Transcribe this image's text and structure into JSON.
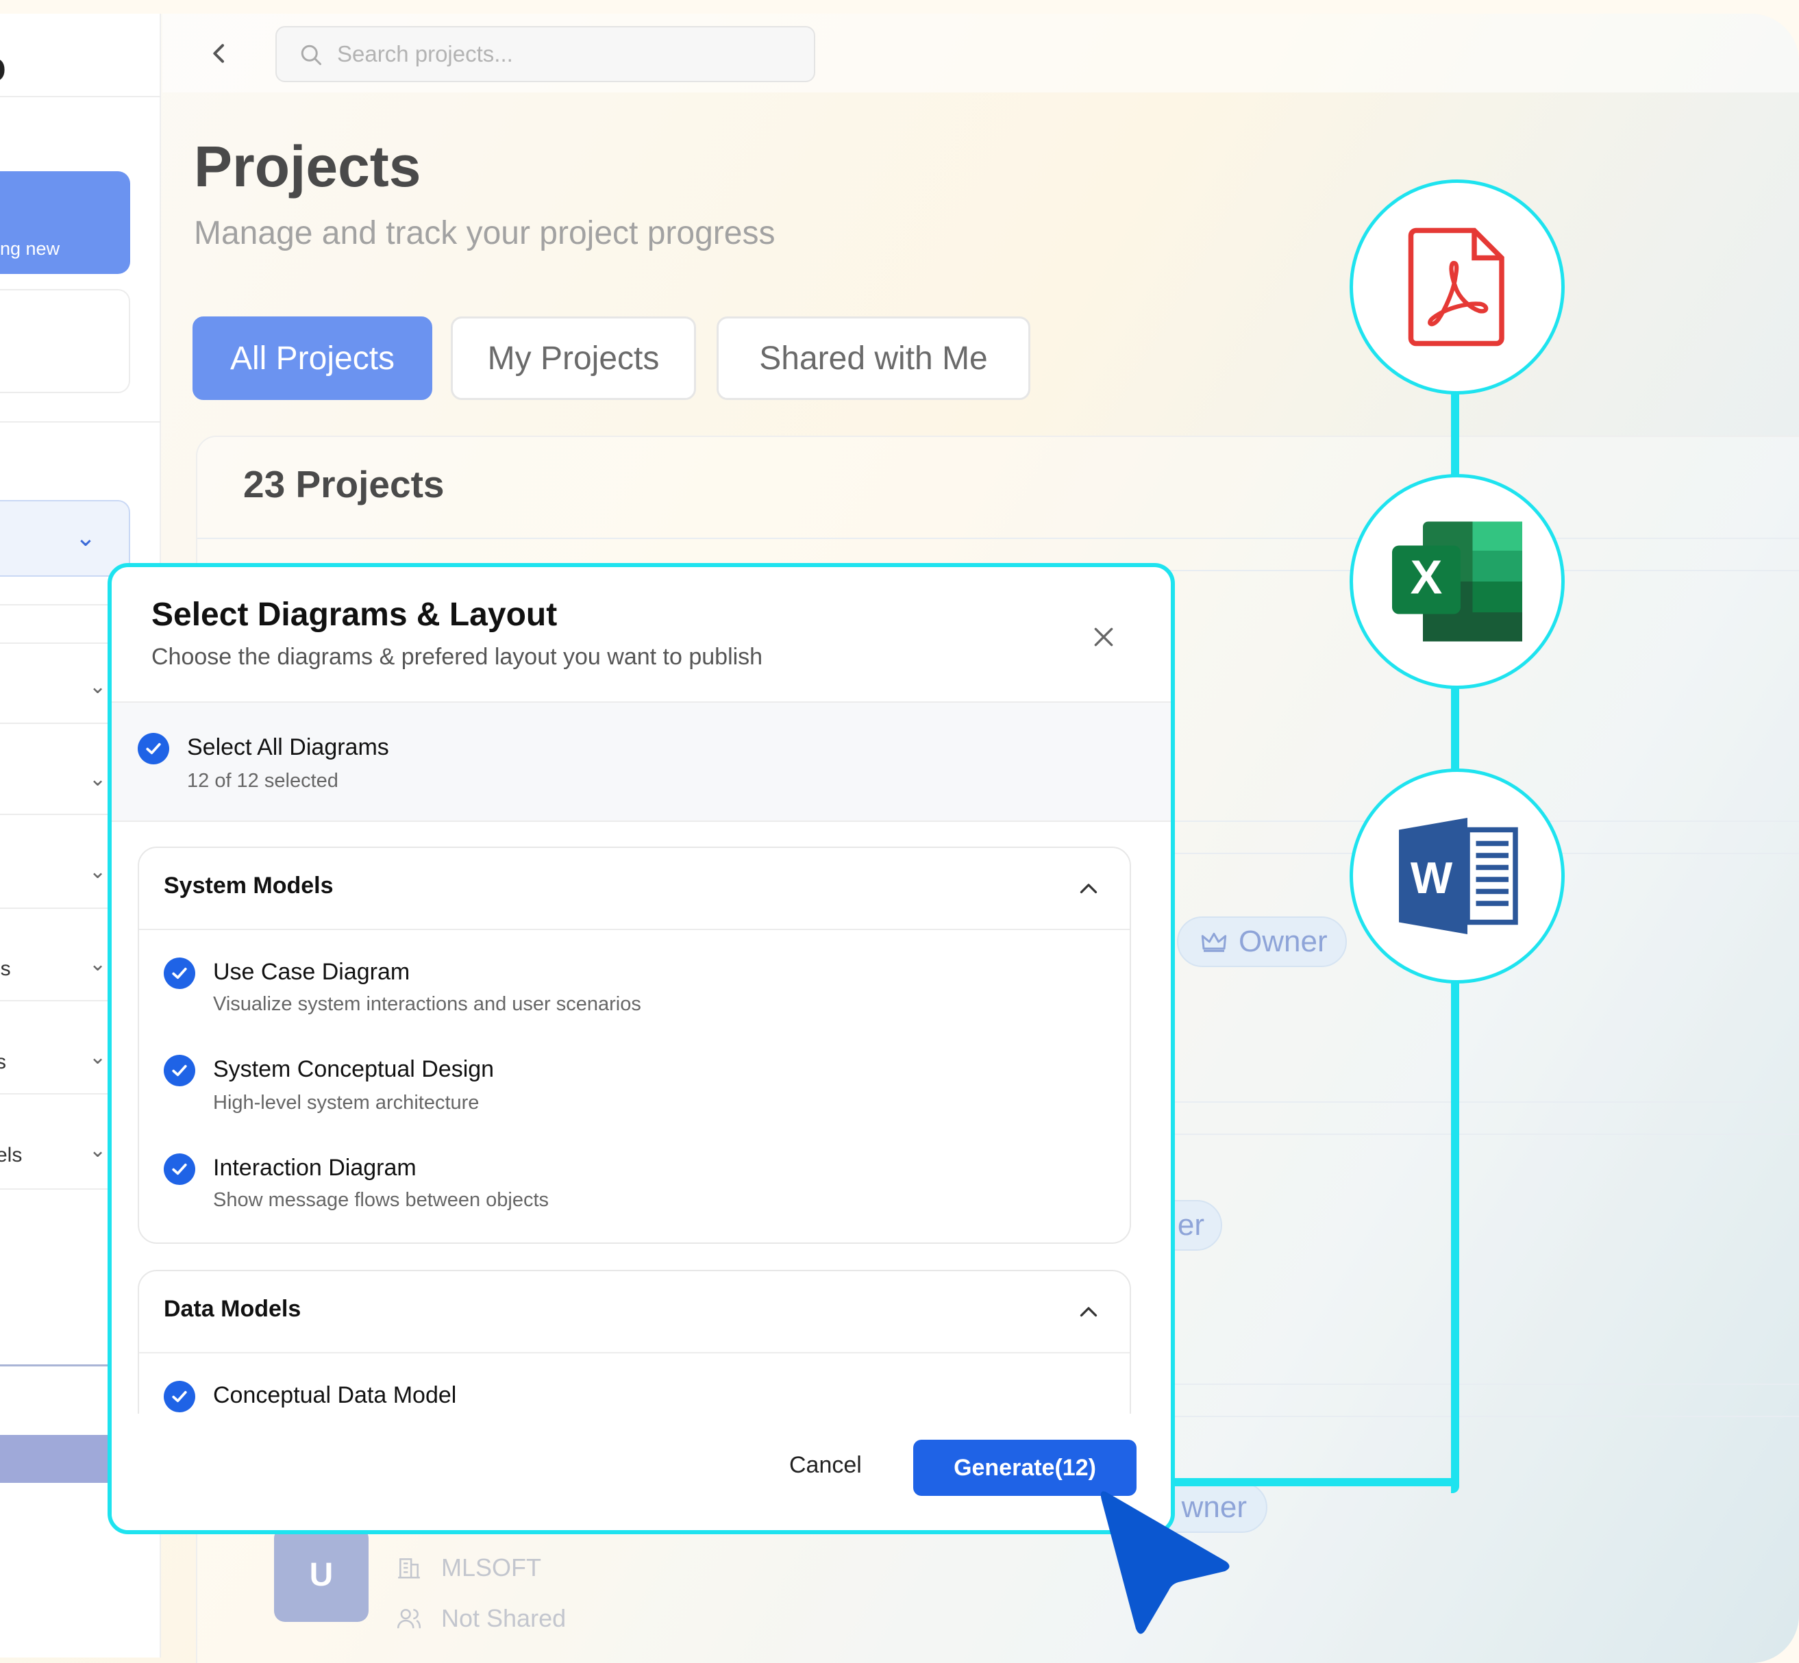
{
  "sidebar": {
    "logo_fragment": "o",
    "new_button_fragment": "ng new",
    "items": [
      {
        "label": ""
      },
      {
        "label": ""
      },
      {
        "label": ""
      },
      {
        "label": "ls"
      },
      {
        "label": "s"
      },
      {
        "label": "els"
      }
    ]
  },
  "search": {
    "placeholder": "Search projects..."
  },
  "page": {
    "title": "Projects",
    "subtitle": "Manage and track your project progress"
  },
  "tabs": [
    {
      "label": "All Projects",
      "active": true
    },
    {
      "label": "My Projects",
      "active": false
    },
    {
      "label": "Shared with Me",
      "active": false
    }
  ],
  "projects": {
    "count_label": "23 Projects",
    "badges": [
      "Owner",
      "er",
      "wner"
    ],
    "last_row": {
      "avatar": "U",
      "company": "MLSOFT",
      "sharing": "Not Shared"
    }
  },
  "export_formats": [
    {
      "icon": "pdf-icon",
      "letter": ""
    },
    {
      "icon": "excel-icon",
      "letter": "X"
    },
    {
      "icon": "word-icon",
      "letter": "W"
    }
  ],
  "modal": {
    "title": "Select Diagrams & Layout",
    "subtitle": "Choose the diagrams & prefered layout you want to publish",
    "select_all_label": "Select All Diagrams",
    "select_all_count": "12 of 12 selected",
    "groups": [
      {
        "title": "System Models",
        "items": [
          {
            "label": "Use Case Diagram",
            "desc": "Visualize system interactions and user scenarios",
            "checked": true
          },
          {
            "label": "System Conceptual Design",
            "desc": "High-level system architecture",
            "checked": true
          },
          {
            "label": "Interaction Diagram",
            "desc": "Show message flows between objects",
            "checked": true
          }
        ]
      },
      {
        "title": "Data Models",
        "items": [
          {
            "label": "Conceptual Data Model",
            "desc": "",
            "checked": true
          }
        ]
      }
    ],
    "cancel_label": "Cancel",
    "generate_label": "Generate(12)"
  },
  "colors": {
    "accent": "#1f63e6",
    "tab_active": "#6b93f0",
    "connector": "#1ee3ef",
    "pdf": "#e53935",
    "excel": "#1d7a45",
    "word": "#2b579a"
  }
}
